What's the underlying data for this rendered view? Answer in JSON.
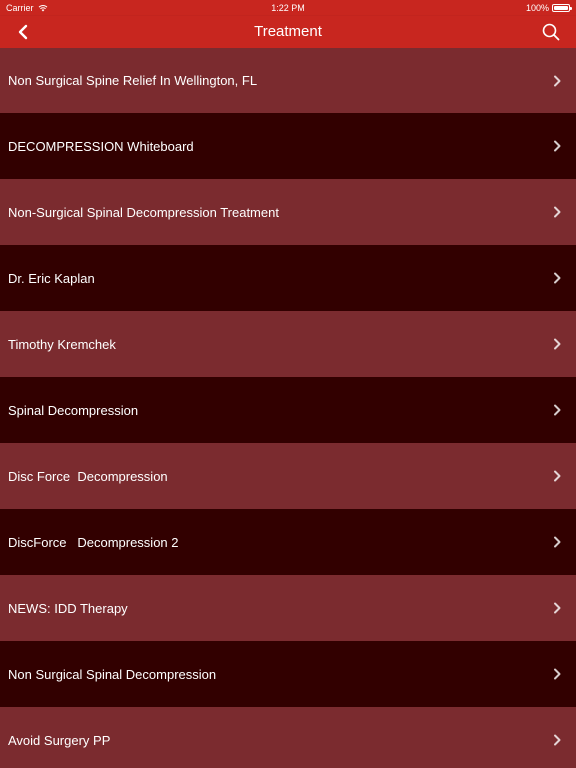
{
  "status_bar": {
    "carrier": "Carrier",
    "time": "1:22 PM",
    "battery_text": "100%",
    "battery_level": 1.0
  },
  "nav": {
    "title": "Treatment",
    "back_icon": "chevron-left-icon",
    "search_icon": "search-icon",
    "color": "#c8261f"
  },
  "colors": {
    "row_light": "#7b2b2f",
    "row_dark": "#320000",
    "text": "#ffffff"
  },
  "items": [
    {
      "label": "Non Surgical Spine Relief In Wellington, FL"
    },
    {
      "label": "DECOMPRESSION Whiteboard"
    },
    {
      "label": "Non-Surgical Spinal Decompression Treatment"
    },
    {
      "label": "Dr. Eric Kaplan"
    },
    {
      "label": "Timothy Kremchek"
    },
    {
      "label": "Spinal Decompression"
    },
    {
      "label": "Disc Force  Decompression"
    },
    {
      "label": "DiscForce   Decompression 2"
    },
    {
      "label": "NEWS: IDD Therapy"
    },
    {
      "label": "Non Surgical Spinal Decompression"
    },
    {
      "label": "Avoid Surgery PP"
    }
  ]
}
